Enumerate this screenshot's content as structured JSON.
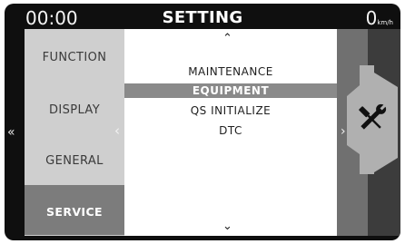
{
  "status_bar": {
    "time": "00:00",
    "title": "SETTING",
    "speed_value": "0",
    "speed_unit": "km/h"
  },
  "left_menu": {
    "items": [
      {
        "label": "FUNCTION",
        "active": false
      },
      {
        "label": "DISPLAY",
        "active": false
      },
      {
        "label": "GENERAL",
        "active": false
      },
      {
        "label": "SERVICE",
        "active": true
      }
    ]
  },
  "center_list": {
    "items": [
      {
        "label": "MAINTENANCE",
        "selected": false
      },
      {
        "label": "EQUIPMENT",
        "selected": true
      },
      {
        "label": "QS INITIALIZE",
        "selected": false
      },
      {
        "label": "DTC",
        "selected": false
      }
    ]
  },
  "nav": {
    "left_double": "«",
    "left_single": "‹",
    "right_single": "›",
    "up": "⌃",
    "down": "⌄"
  },
  "right_panel": {
    "icon": "tools-icon"
  },
  "colors": {
    "frame": "#0f0f0f",
    "left_column": "#cfcfcf",
    "active_left": "#7c7c7c",
    "selected_row": "#8a8a8a",
    "right_panel": "#707070"
  }
}
